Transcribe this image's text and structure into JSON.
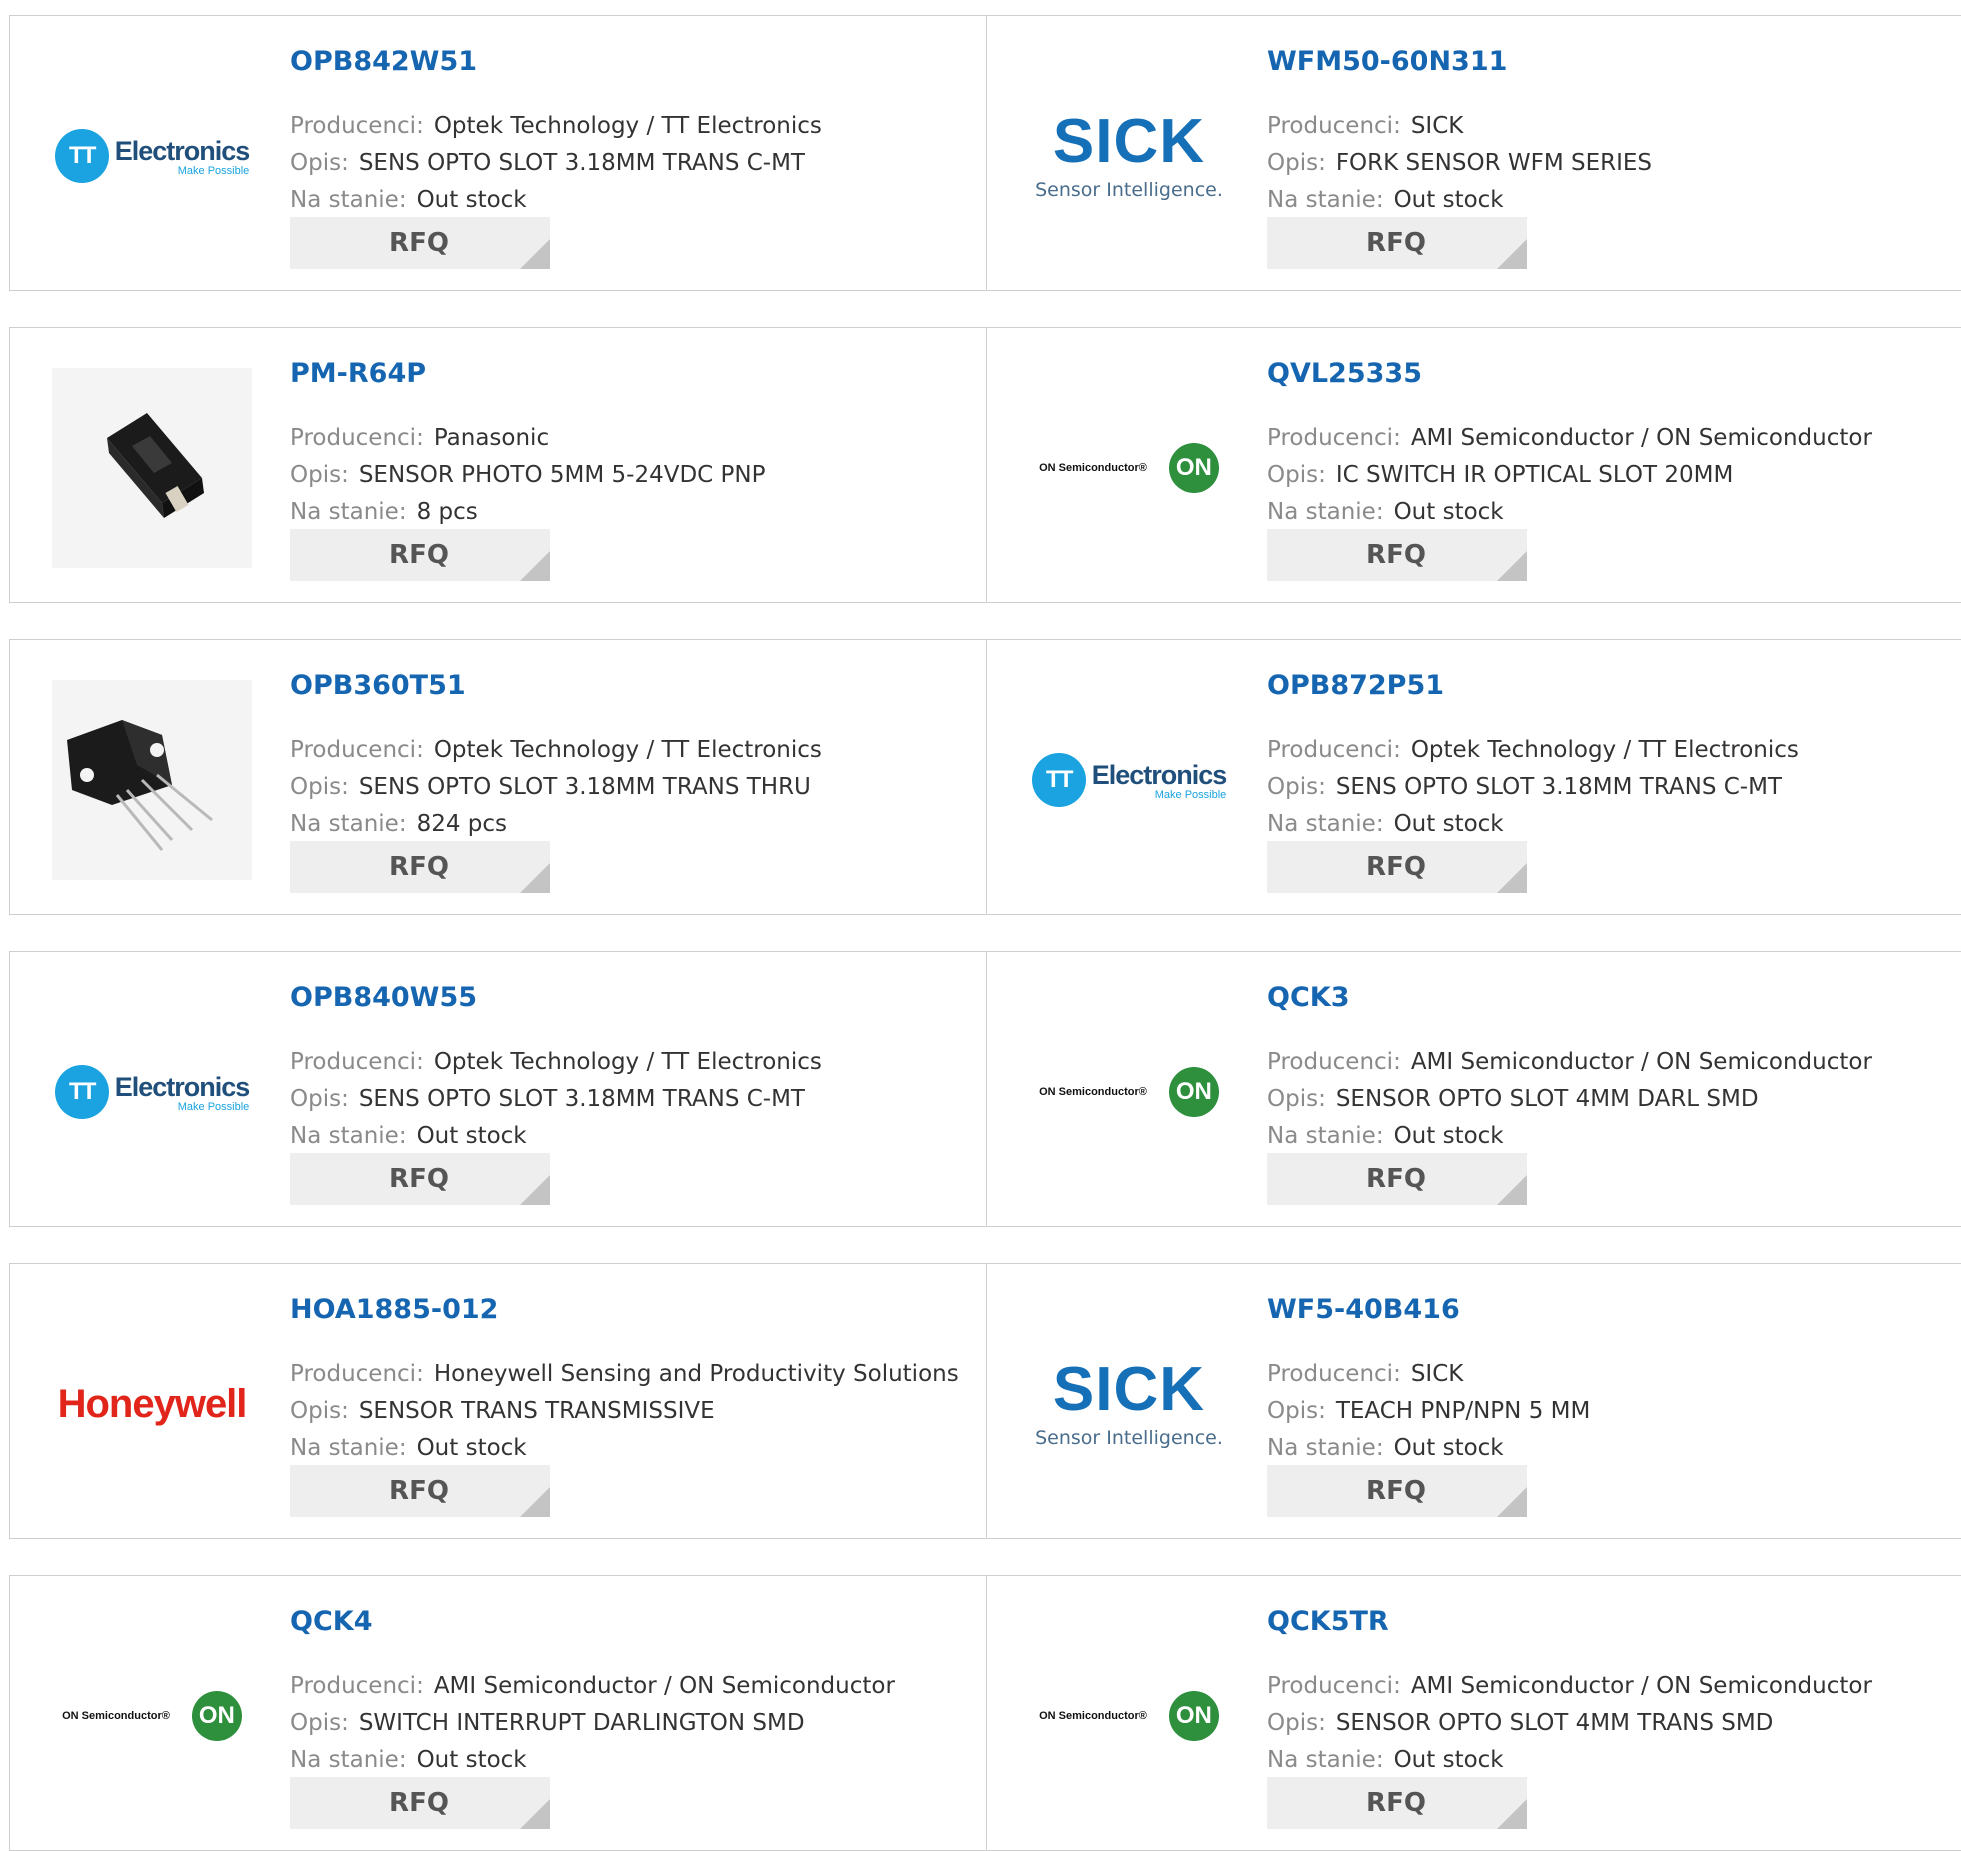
{
  "labels": {
    "manufacturer": "Producenci:",
    "description": "Opis:",
    "stock": "Na stanie:",
    "rfq": "RFQ"
  },
  "products": [
    {
      "part": "OPB842W51",
      "manufacturer": "Optek Technology / TT Electronics",
      "description": "SENS OPTO SLOT 3.18MM TRANS C-MT",
      "stock": "Out stock",
      "logo": "tt-electronics"
    },
    {
      "part": "WFM50-60N311",
      "manufacturer": "SICK",
      "description": "FORK SENSOR WFM SERIES",
      "stock": "Out stock",
      "logo": "sick"
    },
    {
      "part": "PM-R64P",
      "manufacturer": "Panasonic",
      "description": "SENSOR PHOTO 5MM 5-24VDC PNP",
      "stock": "8 pcs",
      "logo": "photo-sensor-a"
    },
    {
      "part": "QVL25335",
      "manufacturer": "AMI Semiconductor / ON Semiconductor",
      "description": "IC SWITCH IR OPTICAL SLOT 20MM",
      "stock": "Out stock",
      "logo": "on-semi"
    },
    {
      "part": "OPB360T51",
      "manufacturer": "Optek Technology / TT Electronics",
      "description": "SENS OPTO SLOT 3.18MM TRANS THRU",
      "stock": "824 pcs",
      "logo": "photo-sensor-b"
    },
    {
      "part": "OPB872P51",
      "manufacturer": "Optek Technology / TT Electronics",
      "description": "SENS OPTO SLOT 3.18MM TRANS C-MT",
      "stock": "Out stock",
      "logo": "tt-electronics"
    },
    {
      "part": "OPB840W55",
      "manufacturer": "Optek Technology / TT Electronics",
      "description": "SENS OPTO SLOT 3.18MM TRANS C-MT",
      "stock": "Out stock",
      "logo": "tt-electronics"
    },
    {
      "part": "QCK3",
      "manufacturer": "AMI Semiconductor / ON Semiconductor",
      "description": "SENSOR OPTO SLOT 4MM DARL SMD",
      "stock": "Out stock",
      "logo": "on-semi"
    },
    {
      "part": "HOA1885-012",
      "manufacturer": "Honeywell Sensing and Productivity Solutions",
      "description": "SENSOR TRANS TRANSMISSIVE",
      "stock": "Out stock",
      "logo": "honeywell"
    },
    {
      "part": "WF5-40B416",
      "manufacturer": "SICK",
      "description": "TEACH PNP/NPN 5 MM",
      "stock": "Out stock",
      "logo": "sick"
    },
    {
      "part": "QCK4",
      "manufacturer": "AMI Semiconductor / ON Semiconductor",
      "description": "SWITCH INTERRUPT DARLINGTON SMD",
      "stock": "Out stock",
      "logo": "on-semi"
    },
    {
      "part": "QCK5TR",
      "manufacturer": "AMI Semiconductor / ON Semiconductor",
      "description": "SENSOR OPTO SLOT 4MM TRANS SMD",
      "stock": "Out stock",
      "logo": "on-semi"
    }
  ],
  "logo_text": {
    "tt_mark": "TT",
    "tt_name": "Electronics",
    "tt_tagline": "Make Possible",
    "sick_name": "SICK",
    "sick_tagline": "Sensor Intelligence.",
    "on_name": "ON Semiconductor®",
    "on_mark": "ON",
    "honeywell_name": "Honeywell"
  },
  "colors": {
    "part_link": "#1565b0",
    "label": "#8a8a8a",
    "value": "#333333",
    "rfq_bg": "#eeeeee",
    "border": "#cfcfcf"
  }
}
